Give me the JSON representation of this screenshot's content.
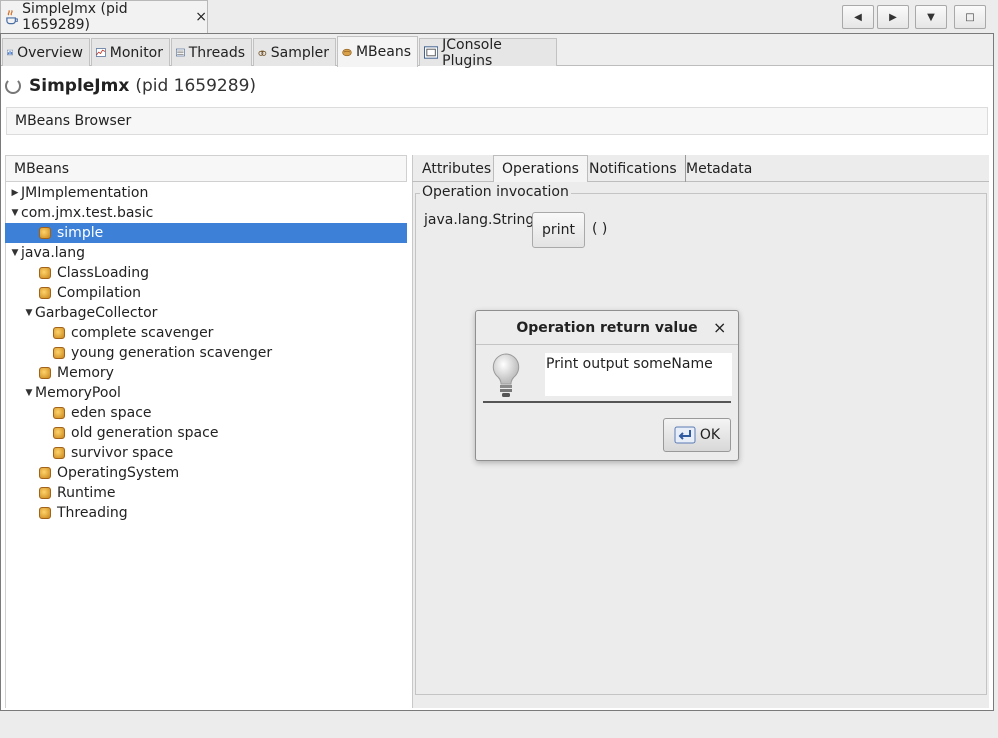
{
  "window": {
    "tab_title": "SimpleJmx (pid 1659289)",
    "close_glyph": "×",
    "controls": [
      "◀",
      "▶",
      "▼",
      "□"
    ]
  },
  "tabs": [
    {
      "label": "Overview",
      "icon": "overview-icon"
    },
    {
      "label": "Monitor",
      "icon": "monitor-icon"
    },
    {
      "label": "Threads",
      "icon": "threads-icon"
    },
    {
      "label": "Sampler",
      "icon": "sampler-icon"
    },
    {
      "label": "MBeans",
      "icon": "mbeans-icon"
    },
    {
      "label": "JConsole Plugins",
      "icon": "plugins-icon"
    }
  ],
  "header": {
    "app_name": "SimpleJmx",
    "pid": "(pid 1659289)",
    "section": "MBeans Browser"
  },
  "tree": {
    "title": "MBeans",
    "items": [
      {
        "label": "JMImplementation",
        "kind": "folder",
        "expanded": false
      },
      {
        "label": "com.jmx.test.basic",
        "kind": "folder",
        "expanded": true
      },
      {
        "label": "simple",
        "kind": "bean",
        "selected": true
      },
      {
        "label": "java.lang",
        "kind": "folder",
        "expanded": true
      },
      {
        "label": "ClassLoading",
        "kind": "bean"
      },
      {
        "label": "Compilation",
        "kind": "bean"
      },
      {
        "label": "GarbageCollector",
        "kind": "folder",
        "expanded": true
      },
      {
        "label": "complete scavenger",
        "kind": "bean"
      },
      {
        "label": "young generation scavenger",
        "kind": "bean"
      },
      {
        "label": "Memory",
        "kind": "bean"
      },
      {
        "label": "MemoryPool",
        "kind": "folder",
        "expanded": true
      },
      {
        "label": "eden space",
        "kind": "bean"
      },
      {
        "label": "old generation space",
        "kind": "bean"
      },
      {
        "label": "survivor space",
        "kind": "bean"
      },
      {
        "label": "OperatingSystem",
        "kind": "bean"
      },
      {
        "label": "Runtime",
        "kind": "bean"
      },
      {
        "label": "Threading",
        "kind": "bean"
      }
    ]
  },
  "detail": {
    "tabs": [
      "Attributes",
      "Operations",
      "Notifications",
      "Metadata"
    ],
    "active_tab": "Operations",
    "group_title": "Operation invocation",
    "return_type": "java.lang.String",
    "operation": "print",
    "params": "( )"
  },
  "dialog": {
    "title": "Operation return value",
    "close_glyph": "×",
    "message": "Print output someName",
    "ok_label": "OK"
  },
  "colors": {
    "selection": "#3d80d8",
    "window_bg": "#ececec"
  }
}
